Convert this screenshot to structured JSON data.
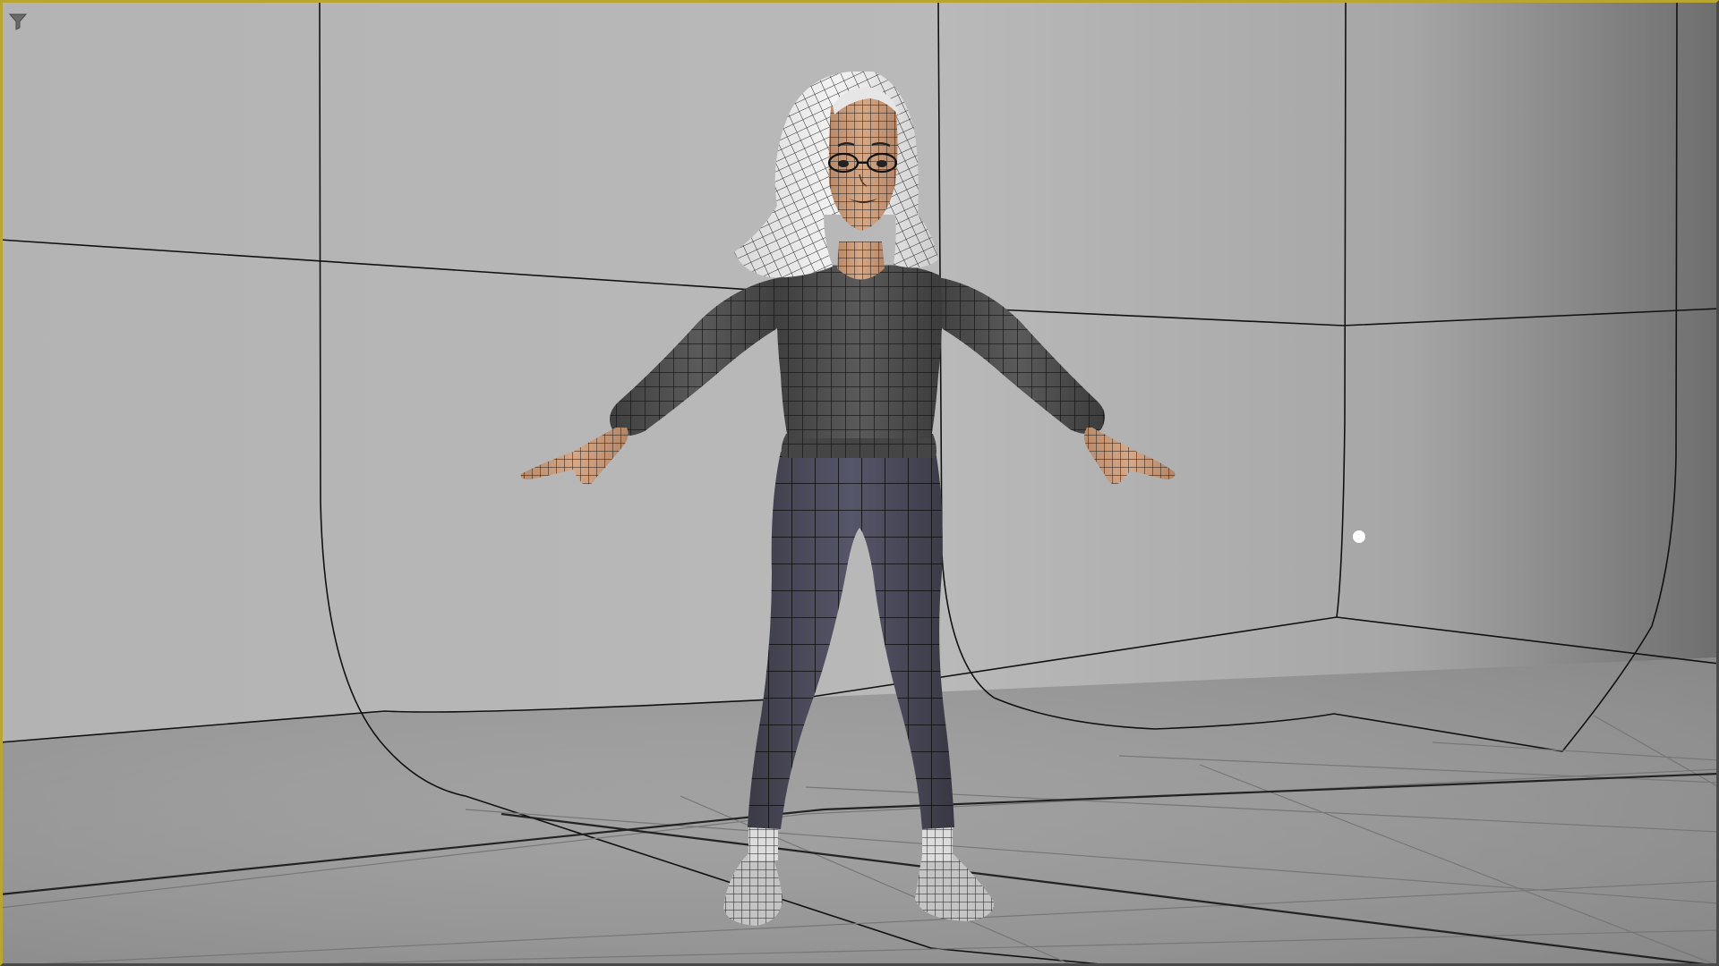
{
  "viewport": {
    "background": "#a9a9a9",
    "active_border_color": "#b9a62e",
    "icons": {
      "filter": "filter-icon"
    }
  },
  "scene": {
    "objects": [
      "studio-cyclorama-backdrop",
      "floor-grid",
      "character-model",
      "light-locator"
    ],
    "character": {
      "pose": "A-pose",
      "display_mode": "smooth-shade-with-wireframe",
      "colors": {
        "skin": "#c79a78",
        "hair": "#e8e8e8",
        "sweater": "#4f4f4f",
        "pants": "#4a4a58",
        "socks": "#dcdcdc",
        "shoes": "#bdbdbd",
        "wire": "#111111"
      }
    },
    "light_color": "#ffffff"
  }
}
